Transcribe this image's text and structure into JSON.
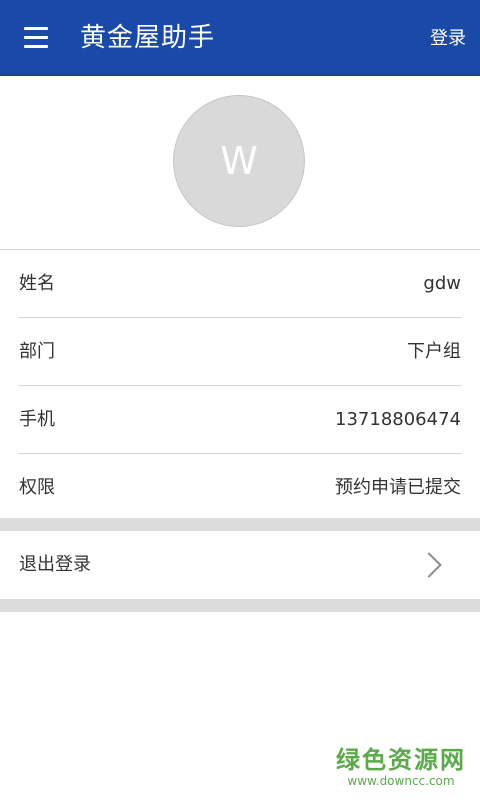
{
  "toolbar": {
    "menu_icon": "menu-icon",
    "title": "黄金屋助手",
    "login_label": "登录"
  },
  "profile": {
    "avatar_initial": "W"
  },
  "info": [
    {
      "label": "姓名",
      "value": "gdw"
    },
    {
      "label": "部门",
      "value": "下户组"
    },
    {
      "label": "手机",
      "value": "13718806474"
    },
    {
      "label": "权限",
      "value": "预约申请已提交"
    }
  ],
  "logout": {
    "label": "退出登录",
    "icon": "chevron-right-icon"
  },
  "watermark": {
    "text": "绿色资源网",
    "url": "www.downcc.com"
  },
  "colors": {
    "toolbar": "#1a4aa8",
    "avatar_bg": "#d9d9d9",
    "divider_bar": "#dcdcdc",
    "watermark": "#5aaa4a"
  }
}
